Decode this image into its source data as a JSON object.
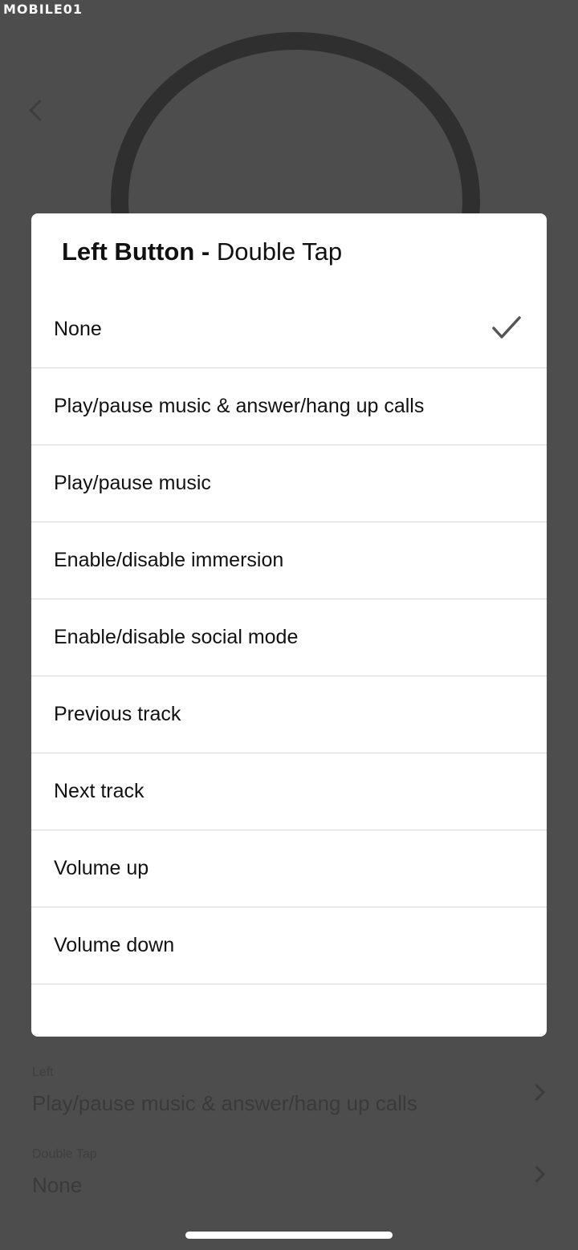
{
  "watermark": "MOBILE01",
  "background": {
    "items": [
      {
        "caption": "Left",
        "value": "Play/pause music & answer/hang up calls"
      },
      {
        "caption": "Double Tap",
        "value": "None"
      }
    ]
  },
  "dialog": {
    "title_bold": "Left Button - ",
    "title_regular": "Double Tap",
    "options": [
      {
        "label": "None",
        "selected": true
      },
      {
        "label": "Play/pause music & answer/hang up calls",
        "selected": false
      },
      {
        "label": "Play/pause music",
        "selected": false
      },
      {
        "label": "Enable/disable immersion",
        "selected": false
      },
      {
        "label": "Enable/disable social mode",
        "selected": false
      },
      {
        "label": "Previous track",
        "selected": false
      },
      {
        "label": "Next track",
        "selected": false
      },
      {
        "label": "Volume up",
        "selected": false
      },
      {
        "label": "Volume down",
        "selected": false
      }
    ],
    "check_icon": "checkmark-icon",
    "colors": {
      "check": "#555555",
      "divider": "#d9d9d9",
      "overlay": "#4d4d4d"
    }
  }
}
